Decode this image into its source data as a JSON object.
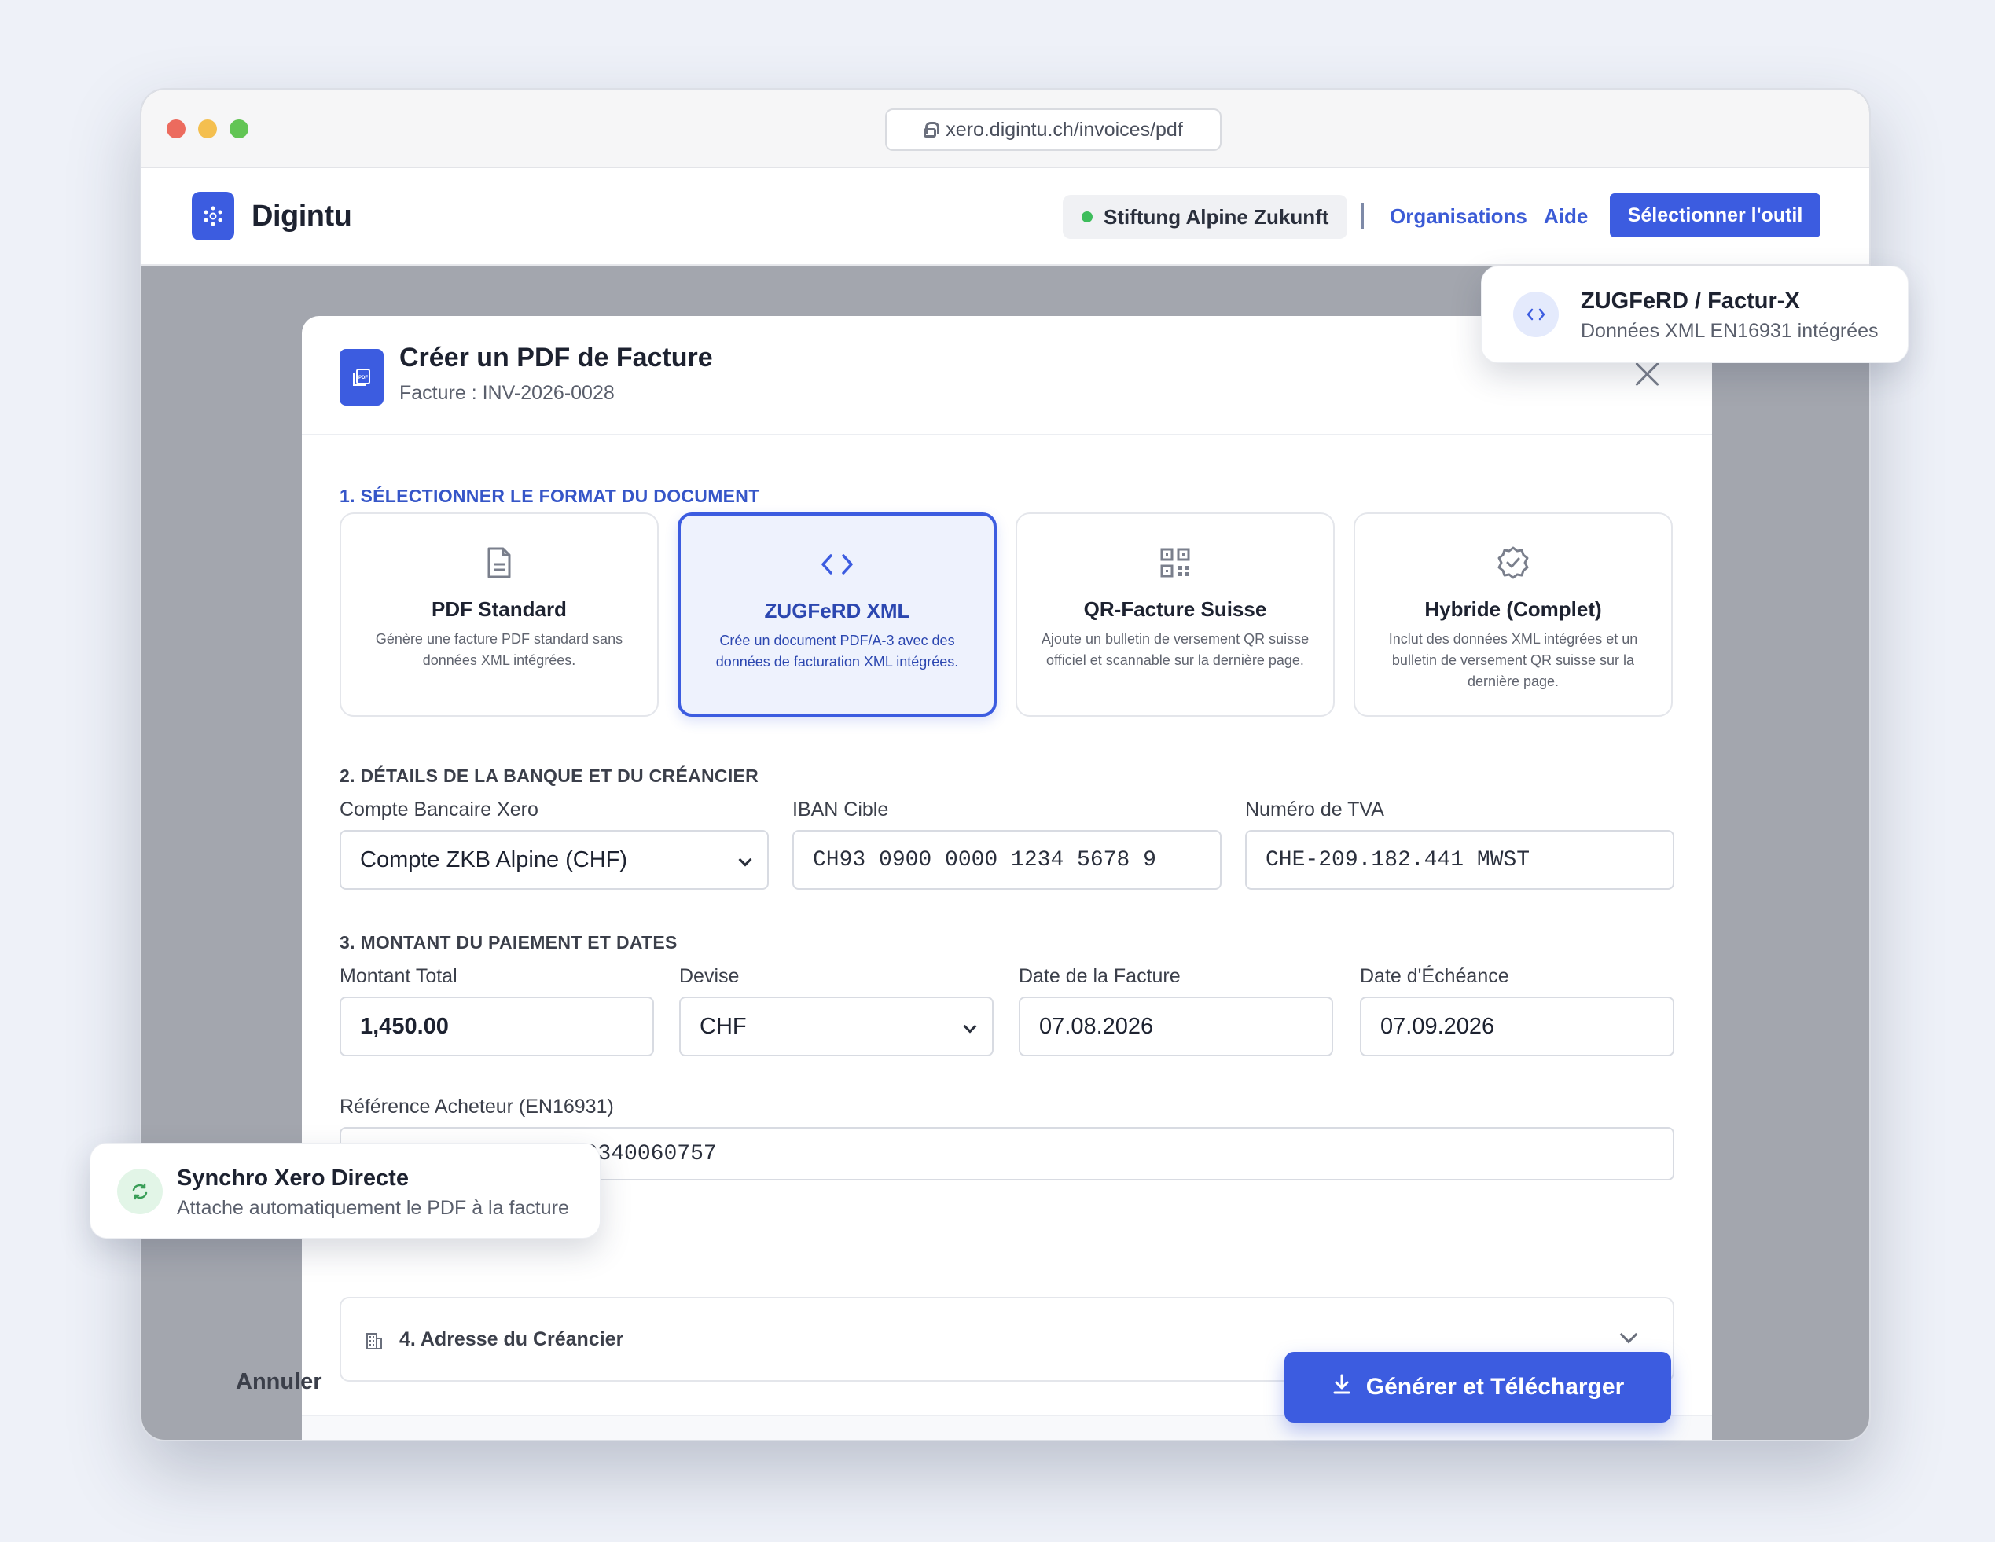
{
  "browser": {
    "url": "xero.digintu.ch/invoices/pdf"
  },
  "header": {
    "brand": "Digintu",
    "organization": "Stiftung Alpine Zukunft",
    "link_organisations": "Organisations",
    "link_help": "Aide",
    "select_tool_label": "Sélectionner l'outil"
  },
  "modal": {
    "title": "Créer un PDF de Facture",
    "subtitle": "Facture : INV-2026-0028",
    "section1_title": "1. SÉLECTIONNER LE FORMAT DU DOCUMENT",
    "formats": [
      {
        "title": "PDF Standard",
        "description": "Génère une facture PDF standard sans données XML intégrées.",
        "icon": "document-icon",
        "selected": false
      },
      {
        "title": "ZUGFeRD XML",
        "description": "Crée un document PDF/A-3 avec des données de facturation XML intégrées.",
        "icon": "code-icon",
        "selected": true
      },
      {
        "title": "QR-Facture Suisse",
        "description": "Ajoute un bulletin de versement QR suisse officiel et scannable sur la dernière page.",
        "icon": "qr-code-icon",
        "selected": false
      },
      {
        "title": "Hybride (Complet)",
        "description": "Inclut des données XML intégrées et un bulletin de versement QR suisse sur la dernière page.",
        "icon": "badge-check-icon",
        "selected": false
      }
    ],
    "section2_title": "2. DÉTAILS DE LA BANQUE ET DU CRÉANCIER",
    "bank_account_label": "Compte Bancaire Xero",
    "bank_account_value": "Compte ZKB Alpine (CHF)",
    "iban_label": "IBAN Cible",
    "iban_value": "CH93 0900 0000 1234 5678 9",
    "vat_label": "Numéro de TVA",
    "vat_value": "CHE-209.182.441 MWST",
    "section3_title": "3. MONTANT DU PAIEMENT ET DATES",
    "amount_label": "Montant Total",
    "amount_value": "1,450.00",
    "currency_label": "Devise",
    "currency_value": "CHF",
    "invoice_date_label": "Date de la Facture",
    "invoice_date_value": "07.08.2026",
    "due_date_label": "Date d'Échéance",
    "due_date_value": "07.09.2026",
    "buyer_ref_label": "Référence Acheteur (EN16931)",
    "buyer_ref_value": "000886173515641430340060757",
    "creditor_address_label": "4. Adresse du Créancier",
    "cancel_label": "Annuler",
    "generate_label": "Générer et Télécharger"
  },
  "toasts": {
    "zugferd_title": "ZUGFeRD / Factur-X",
    "zugferd_sub": "Données XML EN16931 intégrées",
    "sync_title": "Synchro Xero Directe",
    "sync_sub": "Attache automatiquement le PDF à la facture"
  },
  "colors": {
    "accent": "#3c5ce0",
    "status_online": "#3ebd5c",
    "overlay": "#a3a6ae"
  }
}
